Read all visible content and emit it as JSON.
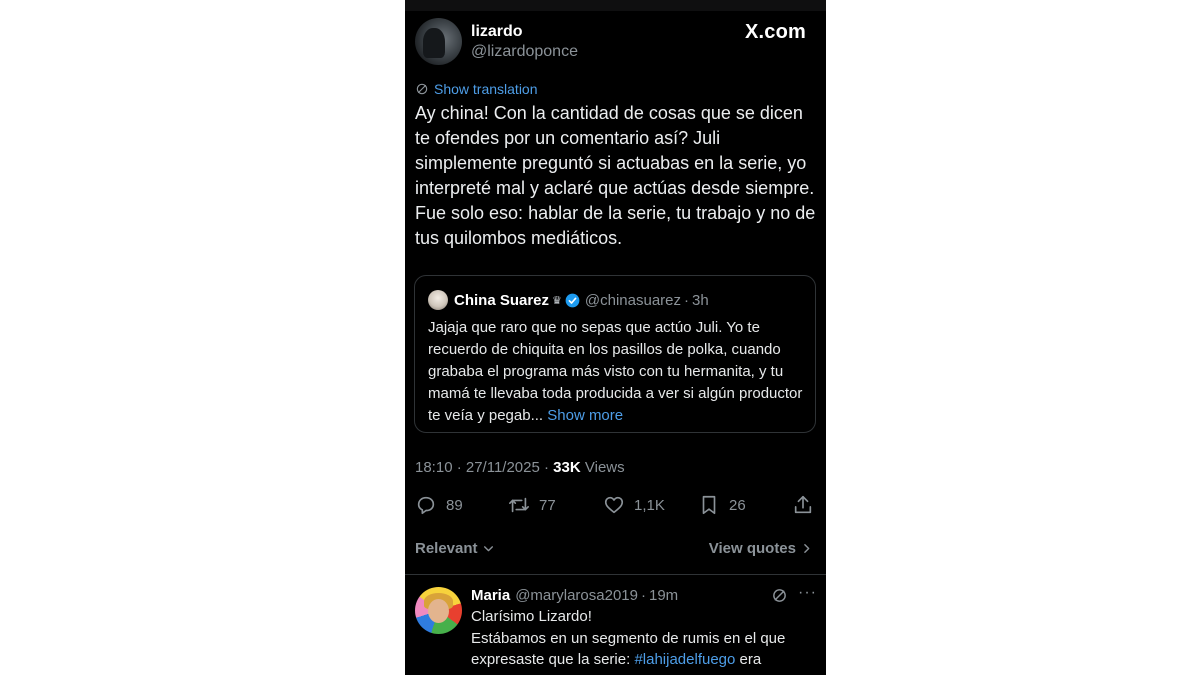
{
  "brand": "X.com",
  "tweet": {
    "author_name": "lizardo",
    "author_handle": "@lizardoponce",
    "translate_label": "Show translation",
    "text": "Ay china! Con la cantidad de cosas que se dicen te ofendes por un comentario así? Juli simplemente preguntó si actuabas en la serie, yo interpreté mal y aclaré que actúas desde siempre. Fue solo eso: hablar de la serie, tu trabajo y no de tus quilombos mediáticos.",
    "quoted": {
      "name": "China Suarez",
      "crown": "♛",
      "handle": "@chinasuarez",
      "dot": "·",
      "time": "3h",
      "text": "Jajaja que raro que no sepas que actúo Juli. Yo te recuerdo de chiquita en los pasillos de polka, cuando grababa el programa más visto con tu hermanita, y tu mamá te llevaba toda producida a ver si algún productor te veía y pegab... ",
      "show_more": "Show more"
    },
    "time_date": "18:10 · 27/11/2025 ·",
    "views_count": "33K",
    "views_label": "Views",
    "stats": {
      "replies": "89",
      "reposts": "77",
      "likes": "1,1K",
      "bookmarks": "26"
    }
  },
  "sort": {
    "relevant_label": "Relevant",
    "view_quotes_label": "View quotes"
  },
  "reply": {
    "name": "Maria",
    "handle": "@marylarosa2019",
    "dot": "·",
    "time": "19m",
    "more": "···",
    "line1": "Clarísimo Lizardo!",
    "line2": "Estábamos en un segmento de rumis en el que expresaste que la serie: ",
    "hashtag": "#lahijadelfuego",
    "line2_tail": " era"
  },
  "colors": {
    "background": "#000000",
    "link": "#4e9ee8",
    "muted": "#8b9298",
    "verified": "#1d9bf0",
    "border": "#2f3336"
  },
  "icons": [
    "translate-icon",
    "verified-badge-icon",
    "reply-icon",
    "repost-icon",
    "like-icon",
    "bookmark-icon",
    "share-icon",
    "chevron-down-icon",
    "chevron-right-icon",
    "more-icon"
  ]
}
